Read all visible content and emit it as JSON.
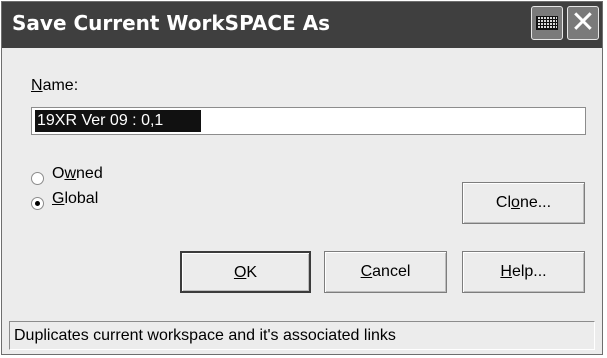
{
  "window": {
    "title": "Save Current WorkSPACE As",
    "keyboard_icon": "keyboard-icon",
    "close_icon": "close-icon",
    "close_glyph": "✕"
  },
  "form": {
    "name_label": "Name:",
    "name_value": "19XR Ver 09 : 0,1",
    "scope_options": [
      {
        "label": "Owned",
        "selected": false
      },
      {
        "label": "Global",
        "selected": true
      }
    ]
  },
  "buttons": {
    "clone": "Clone...",
    "ok": "OK",
    "cancel": "Cancel",
    "help": "Help..."
  },
  "status_bar": {
    "text": "Duplicates current workspace and it's associated links"
  }
}
